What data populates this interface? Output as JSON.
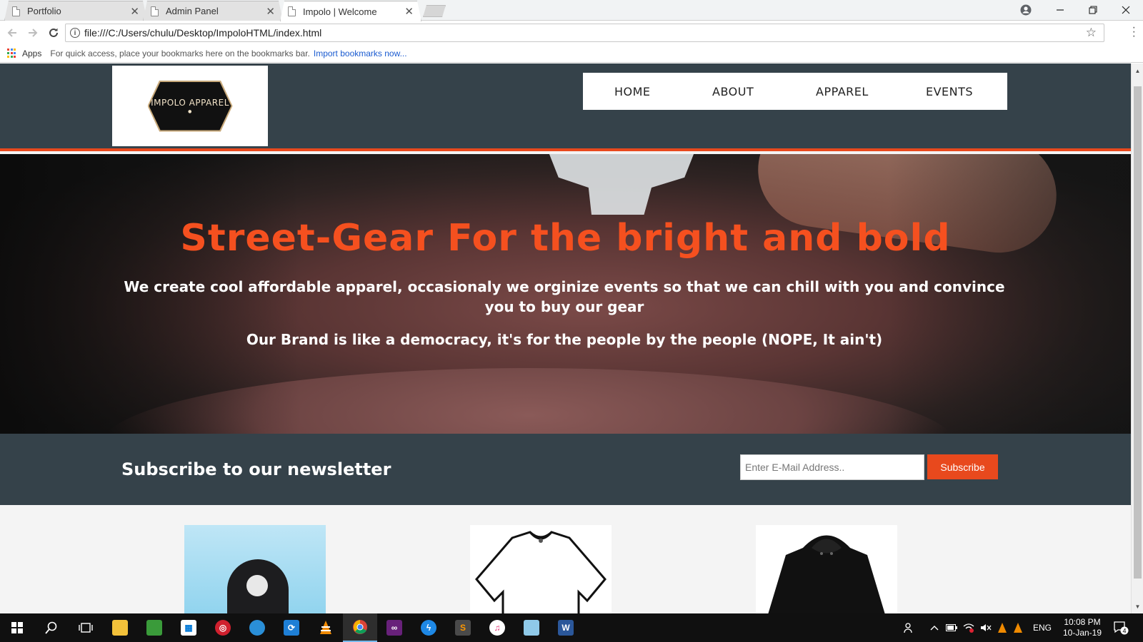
{
  "browser": {
    "tabs": [
      {
        "title": "Portfolio",
        "close": "✕"
      },
      {
        "title": "Admin Panel",
        "close": "✕"
      },
      {
        "title": "Impolo | Welcome",
        "close": "✕"
      }
    ],
    "url": "file:///C:/Users/chulu/Desktop/ImpoloHTML/index.html",
    "bookmarks": {
      "apps_label": "Apps",
      "hint": "For quick access, place your bookmarks here on the bookmarks bar.",
      "import_link": "Import bookmarks now..."
    }
  },
  "site": {
    "logo_text": "IMPOLO APPAREL",
    "nav": [
      "HOME",
      "ABOUT",
      "APPAREL",
      "EVENTS"
    ],
    "hero": {
      "title": "Street-Gear For the bright and bold",
      "subtitle": "We create cool affordable apparel, occasionaly we orginize events so that we can chill with you and convince you to buy our gear",
      "tagline": "Our Brand is like a democracy, it's for the people by the people (NOPE, It ain't)"
    },
    "newsletter": {
      "heading": "Subscribe to our newsletter",
      "email_placeholder": "Enter E-Mail Address..",
      "button": "Subscribe"
    },
    "colors": {
      "header_bg": "#35424a",
      "accent": "#e8491d"
    }
  },
  "taskbar": {
    "language": "ENG",
    "time": "10:08 PM",
    "date": "10-Jan-19",
    "notification_count": "4"
  }
}
